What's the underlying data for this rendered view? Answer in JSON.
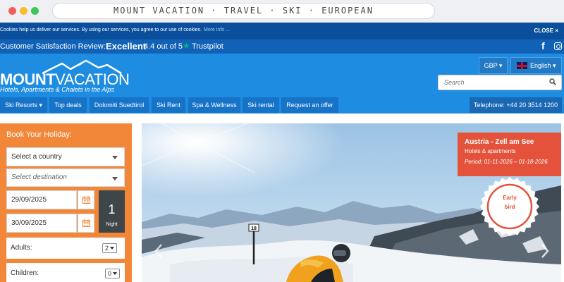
{
  "browser": {
    "url_text": "MOUNT VACATION · TRAVEL · SKI · EUROPEAN"
  },
  "cookie_bar": {
    "message": "Cookies help us deliver our services. By using our services, you agree to our use of cookies.",
    "more_info": "More info ...",
    "close": "CLOSE ×"
  },
  "review": {
    "label": "Customer Satisfaction Review:",
    "rating_word": "Excellent",
    "score": "4.4 out of 5",
    "provider": "Trustpilot"
  },
  "header": {
    "logo_bold": "MOUNT",
    "logo_light": "VACATION",
    "tagline": "Hotels, Apartments & Chalets in the Alps",
    "currency": "GBP ▾",
    "language": "English ▾",
    "search_placeholder": "Search"
  },
  "nav": {
    "items": [
      "Ski Resorts ▾",
      "Top deals",
      "Dolomiti Suedtirol",
      "Ski Rent",
      "Spa & Wellness",
      "Ski rental",
      "Request an offer"
    ],
    "phone": "Telephone: +44 20 3514 1200"
  },
  "booking": {
    "title": "Book Your Holiday:",
    "country_placeholder": "Select a country",
    "destination_placeholder": "Select destination",
    "checkin": "29/09/2025",
    "checkout": "30/09/2025",
    "nights_count": "1",
    "nights_label": "Night",
    "adults_label": "Adults:",
    "adults_value": "2",
    "children_label": "Children:",
    "children_value": "0"
  },
  "promo": {
    "title": "Austria - Zell am See",
    "subtitle": "Hotels & apartments",
    "period": "Period: 01-11-2026 – 01-18-2026",
    "badge_line1": "Early",
    "badge_line2": "bird"
  },
  "hero": {
    "pole_marker": "18"
  },
  "colors": {
    "cookie_bg": "#0b4f9c",
    "header_bg": "#1e8ce0",
    "nav_item_bg": "#1673c8",
    "booking_bg": "#f2873a",
    "promo_bg": "#e4523b",
    "trustpilot_green": "#00b67a"
  }
}
